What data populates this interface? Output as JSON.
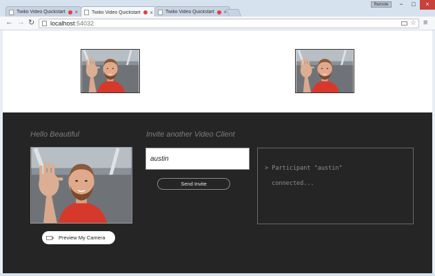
{
  "browser": {
    "tabs": [
      {
        "title": "Twilio Video Quickstart",
        "active": false
      },
      {
        "title": "Twilio Video Quickstart",
        "active": true
      },
      {
        "title": "Twilio Video Quickstart",
        "active": false
      }
    ],
    "close_glyph": "×",
    "user_badge": "Remote",
    "window_controls": {
      "minimize": "−",
      "maximize": "□",
      "close": "×"
    },
    "address": {
      "host": "localhost",
      "port": ":54032"
    },
    "icons": {
      "back": "←",
      "forward": "→",
      "reload": "↻",
      "star": "☆",
      "menu": "≡"
    }
  },
  "page": {
    "hello_label": "Hello Beautiful",
    "invite_label": "Invite another Video Client",
    "invite_value": "austin",
    "send_button": "Send Invite",
    "preview_button": "Preview My Camera",
    "log_lines": [
      "> Participant \"austin\"",
      "  connected..."
    ]
  },
  "colors": {
    "dark_panel": "#252525",
    "recording_dot": "#e04040",
    "close_button": "#c7423a",
    "muted_text": "#7c7c7c"
  }
}
